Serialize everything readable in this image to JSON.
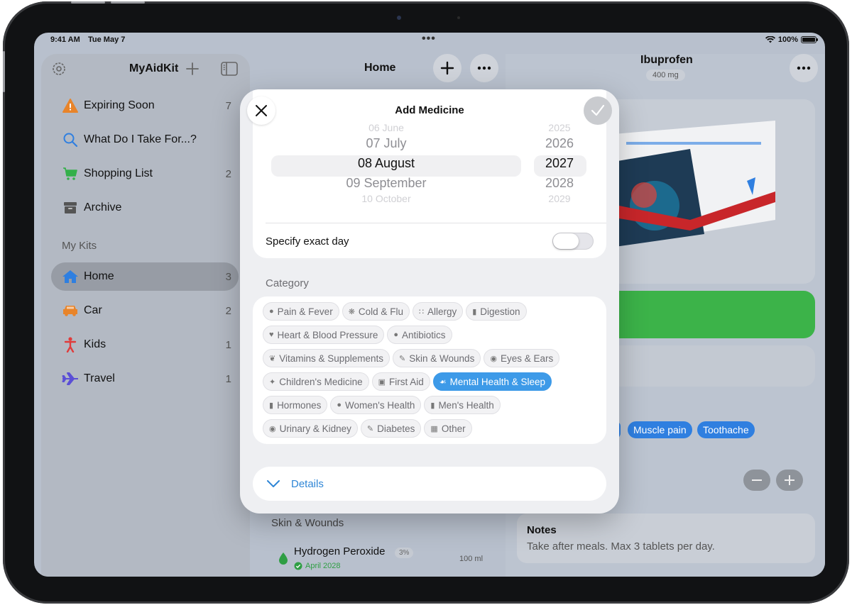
{
  "status_bar": {
    "time": "9:41 AM",
    "date": "Tue May 7",
    "battery": "100%"
  },
  "sidebar": {
    "title": "MyAidKit",
    "section_label": "My Kits",
    "items": [
      {
        "label": "Expiring Soon",
        "count": "7",
        "icon": "warning-icon"
      },
      {
        "label": "What Do I Take For...?",
        "count": "",
        "icon": "search-icon"
      },
      {
        "label": "Shopping List",
        "count": "2",
        "icon": "cart-icon"
      },
      {
        "label": "Archive",
        "count": "",
        "icon": "archive-icon"
      }
    ],
    "kits": [
      {
        "label": "Home",
        "count": "3",
        "icon": "house-icon",
        "active": true
      },
      {
        "label": "Car",
        "count": "2",
        "icon": "car-icon"
      },
      {
        "label": "Kids",
        "count": "1",
        "icon": "child-icon"
      },
      {
        "label": "Travel",
        "count": "1",
        "icon": "airplane-icon"
      }
    ]
  },
  "middle": {
    "title": "Home",
    "section_label": "Skin & Wounds",
    "item": {
      "name": "Hydrogen Peroxide",
      "percent": "3%",
      "expiry": "April 2028",
      "size": "100 ml"
    }
  },
  "detail": {
    "title": "Ibuprofen",
    "subtitle": "400 mg",
    "tags": [
      "Muscle pain",
      "Toothache"
    ],
    "notes_title": "Notes",
    "notes_text": "Take after meals. Max 3 tablets per day."
  },
  "modal": {
    "title": "Add Medicine",
    "picker": {
      "months": [
        "06 June",
        "07 July",
        "08 August",
        "09 September",
        "10 October"
      ],
      "years": [
        "2025",
        "2026",
        "2027",
        "2028",
        "2029"
      ],
      "selected_month": "08 August",
      "selected_year": "2027"
    },
    "exact_day_label": "Specify exact day",
    "exact_day_on": false,
    "category_heading": "Category",
    "categories": [
      [
        "Pain & Fever",
        "Cold & Flu",
        "Allergy",
        "Digestion"
      ],
      [
        "Heart & Blood Pressure",
        "Antibiotics"
      ],
      [
        "Vitamins & Supplements",
        "Skin & Wounds",
        "Eyes & Ears"
      ],
      [
        "Children's Medicine",
        "First Aid",
        "Mental Health & Sleep"
      ],
      [
        "Hormones",
        "Women's Health",
        "Men's Health"
      ],
      [
        "Urinary & Kidney",
        "Diabetes",
        "Other"
      ]
    ],
    "category_icons": [
      [
        "flame-icon",
        "virus-icon",
        "pollen-icon",
        "stomach-icon"
      ],
      [
        "heart-icon",
        "pills-icon"
      ],
      [
        "leaf-icon",
        "bandage-icon",
        "eye-icon"
      ],
      [
        "child-icon",
        "first-aid-kit-icon",
        "brain-icon"
      ],
      [
        "test-tubes-icon",
        "woman-icon",
        "man-icon"
      ],
      [
        "kidney-icon",
        "syringe-icon",
        "grid-icon"
      ]
    ],
    "selected_category": "Mental Health & Sleep",
    "details_label": "Details"
  },
  "colors": {
    "accent": "#3d9ae8",
    "green": "#3cb349",
    "tag_blue": "#2f7fe0"
  }
}
